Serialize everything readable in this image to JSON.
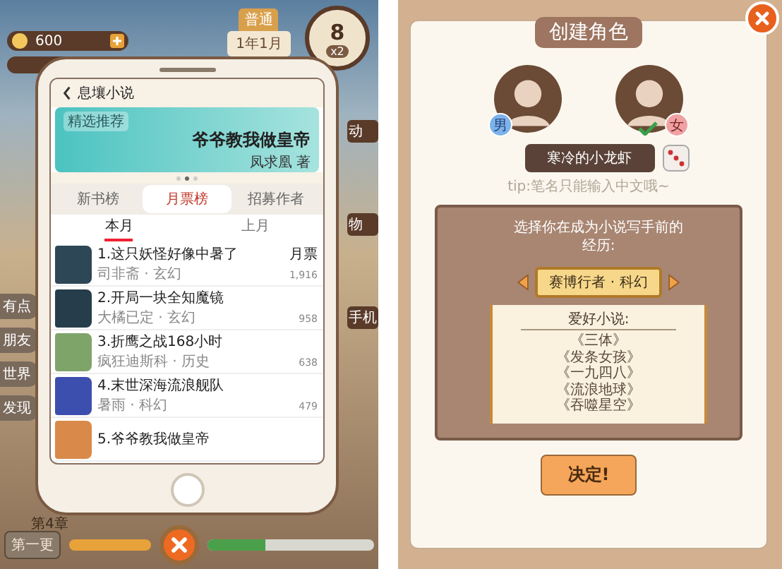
{
  "game_hud": {
    "coins": "600",
    "mode_tab": "普通",
    "date": "1年1月",
    "day": "8",
    "speed": "x2",
    "left_buttons": [
      "有点",
      "朋友",
      "世界",
      "发现"
    ],
    "right_buttons": [
      "动",
      "物",
      "手机"
    ],
    "chapter": "第4章",
    "update_button": "第一更",
    "progress": {
      "level": 0.35
    }
  },
  "phone": {
    "title": "息壤小说",
    "banner": {
      "tag": "精选推荐",
      "title": "爷爷教我做皇帝",
      "author": "凤求凰 著"
    },
    "dots": [
      {
        "selected": false
      },
      {
        "selected": true
      },
      {
        "selected": false
      }
    ],
    "tabs": [
      {
        "label": "新书榜",
        "selected": false
      },
      {
        "label": "月票榜",
        "selected": true
      },
      {
        "label": "招募作者",
        "selected": false
      }
    ],
    "subtabs": [
      {
        "label": "本月",
        "selected": true
      },
      {
        "label": "上月",
        "selected": false
      }
    ],
    "column_header": "月票",
    "books": [
      {
        "title": "1.这只妖怪好像中暑了",
        "meta": "司非斋 · 玄幻",
        "votes": "1,916",
        "color": "#2e4756"
      },
      {
        "title": "2.开局一块全知魔镜",
        "meta": "大橘已定 · 玄幻",
        "votes": "958",
        "color": "#263e4c"
      },
      {
        "title": "3.折鹰之战168小时",
        "meta": "疯狂迪斯科 · 历史",
        "votes": "638",
        "color": "#7fa46a"
      },
      {
        "title": "4.末世深海流浪舰队",
        "meta": "暑雨 · 科幻",
        "votes": "479",
        "color": "#3d4fae"
      },
      {
        "title": "5.爷爷教我做皇帝",
        "color": "#d98a4a"
      }
    ]
  },
  "create": {
    "title": "创建角色",
    "genders": [
      {
        "label": "男",
        "selected": false
      },
      {
        "label": "女",
        "selected": true
      }
    ],
    "name": "寒冷的小龙虾",
    "tip": "tip:笔名只能输入中文哦~",
    "prompt": "选择你在成为小说写手前的经历:",
    "background": "赛博行者 · 科幻",
    "favorites_title": "爱好小说:",
    "favorites": [
      "《三体》",
      "《发条女孩》",
      "《一九四八》",
      "《流浪地球》",
      "《吞噬星空》"
    ],
    "confirm": "决定!"
  }
}
